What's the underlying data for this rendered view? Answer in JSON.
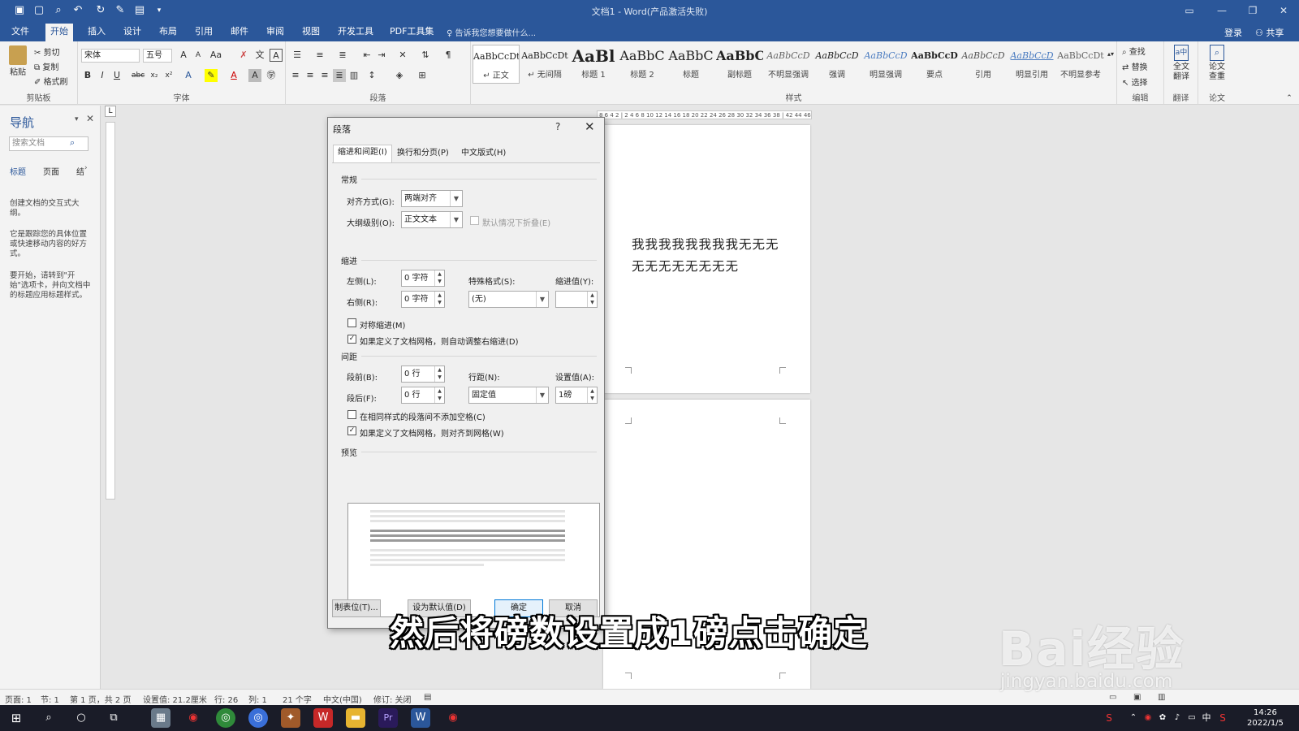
{
  "window": {
    "title": "文档1 - Word(产品激活失败)"
  },
  "ribbon_tabs": [
    "文件",
    "开始",
    "插入",
    "设计",
    "布局",
    "引用",
    "邮件",
    "审阅",
    "视图",
    "开发工具",
    "PDF工具集"
  ],
  "tell_me": "告诉我您想要做什么...",
  "login": "登录",
  "share": "共享",
  "clipboard": {
    "paste": "粘贴",
    "cut": "剪切",
    "copy": "复制",
    "format_painter": "格式刷",
    "label": "剪贴板"
  },
  "font": {
    "name": "宋体",
    "size": "五号",
    "label": "字体"
  },
  "paragraph_label": "段落",
  "styles": {
    "label": "样式",
    "items": [
      {
        "preview": "AaBbCcDt",
        "name": "↵ 正文"
      },
      {
        "preview": "AaBbCcDt",
        "name": "↵ 无间隔"
      },
      {
        "preview": "AaBl",
        "name": "标题 1"
      },
      {
        "preview": "AaBbC",
        "name": "标题 2"
      },
      {
        "preview": "AaBbC",
        "name": "标题"
      },
      {
        "preview": "AaBbC",
        "name": "副标题"
      },
      {
        "preview": "AaBbCcD",
        "name": "不明显强调"
      },
      {
        "preview": "AaBbCcD",
        "name": "强调"
      },
      {
        "preview": "AaBbCcD",
        "name": "明显强调"
      },
      {
        "preview": "AaBbCcD",
        "name": "要点"
      },
      {
        "preview": "AaBbCcD",
        "name": "引用"
      },
      {
        "preview": "AaBbCcD",
        "name": "明显引用"
      },
      {
        "preview": "AaBbCcDt",
        "name": "不明显参考"
      }
    ]
  },
  "editing": {
    "find": "查找",
    "replace": "替换",
    "select": "选择",
    "label": "编辑"
  },
  "translate": {
    "button": "全文翻译",
    "label": "翻译"
  },
  "paper": {
    "button": "论文查重",
    "label": "论文"
  },
  "nav": {
    "title": "导航",
    "search_placeholder": "搜索文档",
    "tabs": [
      "标题",
      "页面",
      "结"
    ],
    "p1": "创建文档的交互式大纲。",
    "p2": "它是跟踪您的具体位置或快速移动内容的好方式。",
    "p3": "要开始，请转到\"开始\"选项卡，并向文档中的标题应用标题样式。"
  },
  "ruler_text": "8 6 4 2 | 2 4 6 8 10 12 14 16 18 20 22 24 26 28 30 32 34 36 38 | 42 44 46 48",
  "document": {
    "text": "我我我我我我我我无无无无无无无无无无无"
  },
  "dialog": {
    "title": "段落",
    "help": "?",
    "tabs": [
      "缩进和间距(I)",
      "换行和分页(P)",
      "中文版式(H)"
    ],
    "general": {
      "heading": "常规",
      "alignment_label": "对齐方式(G):",
      "alignment_value": "两端对齐",
      "outline_label": "大纲级别(O):",
      "outline_value": "正文文本",
      "collapse_label": "默认情况下折叠(E)"
    },
    "indent": {
      "heading": "缩进",
      "left_label": "左侧(L):",
      "left_value": "0 字符",
      "right_label": "右侧(R):",
      "right_value": "0 字符",
      "special_label": "特殊格式(S):",
      "special_value": "(无)",
      "by_label": "缩进值(Y):",
      "by_value": "",
      "mirror_label": "对称缩进(M)",
      "auto_label": "如果定义了文档网格，则自动调整右缩进(D)"
    },
    "spacing": {
      "heading": "间距",
      "before_label": "段前(B):",
      "before_value": "0 行",
      "after_label": "段后(F):",
      "after_value": "0 行",
      "line_label": "行距(N):",
      "line_value": "固定值",
      "at_label": "设置值(A):",
      "at_value": "1磅",
      "nospace_label": "在相同样式的段落间不添加空格(C)",
      "snap_label": "如果定义了文档网格，则对齐到网格(W)"
    },
    "preview_heading": "预览",
    "buttons": {
      "tabs": "制表位(T)...",
      "default": "设为默认值(D)",
      "ok": "确定",
      "cancel": "取消"
    }
  },
  "status": {
    "page": "页面: 1",
    "section": "节: 1",
    "pages": "第 1 页，共 2 页",
    "position": "设置值: 21.2厘米",
    "line": "行: 26",
    "column": "列: 1",
    "chars": "21 个字",
    "lang": "中文(中国)",
    "track": "修订: 关闭"
  },
  "clock": {
    "time": "14:26",
    "date": "2022/1/5"
  },
  "tray": {
    "ime": "中"
  },
  "subtitle": "然后将磅数设置成1磅点击确定",
  "watermark": {
    "brand": "Bai经验",
    "url": "jingyan.baidu.com"
  }
}
